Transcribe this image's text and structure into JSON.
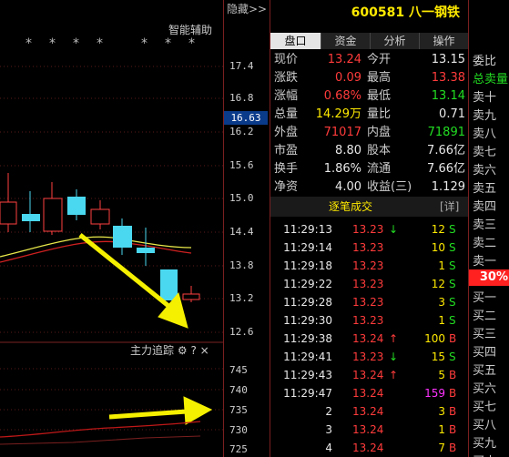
{
  "header": {
    "hide_label": "隐藏>>",
    "code": "600581",
    "name": "八一钢铁",
    "ai_label": "智能辅助"
  },
  "tabs": [
    {
      "label": "盘口",
      "active": true
    },
    {
      "label": "资金"
    },
    {
      "label": "分析"
    },
    {
      "label": "操作"
    }
  ],
  "price_axis": [
    "17.4",
    "16.8",
    "16.2",
    "15.6",
    "15.0",
    "14.4",
    "13.8",
    "13.2",
    "12.6"
  ],
  "current_price": "16.63",
  "vol_axis": [
    "745",
    "740",
    "735",
    "730",
    "725"
  ],
  "indicator": {
    "label": "主力追踪",
    "gear": "gear-icon",
    "help": "?",
    "close": "×"
  },
  "quote": [
    {
      "l1": "现价",
      "v1": "13.24",
      "c1": "red",
      "l2": "今开",
      "v2": "13.15",
      "c2": "white"
    },
    {
      "l1": "涨跌",
      "v1": "0.09",
      "c1": "red",
      "l2": "最高",
      "v2": "13.38",
      "c2": "red"
    },
    {
      "l1": "涨幅",
      "v1": "0.68%",
      "c1": "red",
      "l2": "最低",
      "v2": "13.14",
      "c2": "green"
    },
    {
      "l1": "总量",
      "v1": "14.29万",
      "c1": "yellow",
      "l2": "量比",
      "v2": "0.71",
      "c2": "white"
    },
    {
      "l1": "外盘",
      "v1": "71017",
      "c1": "red",
      "l2": "内盘",
      "v2": "71891",
      "c2": "green"
    },
    {
      "l1": "市盈",
      "v1": "8.80",
      "c1": "white",
      "l2": "股本",
      "v2": "7.66亿",
      "c2": "white"
    },
    {
      "l1": "换手",
      "v1": "1.86%",
      "c1": "white",
      "l2": "流通",
      "v2": "7.66亿",
      "c2": "white"
    },
    {
      "l1": "净资",
      "v1": "4.00",
      "c1": "white",
      "l2": "收益(三)",
      "v2": "1.129",
      "c2": "white"
    }
  ],
  "trades_header": {
    "title": "逐笔成交",
    "detail": "[详]"
  },
  "trades": [
    {
      "t": "11:29:13",
      "p": "13.23",
      "arrow": "↓",
      "ac": "green",
      "v": "12",
      "s": "S",
      "vc": "yellow",
      "sc": "green"
    },
    {
      "t": "11:29:14",
      "p": "13.23",
      "arrow": "",
      "ac": "",
      "v": "10",
      "s": "S",
      "vc": "yellow",
      "sc": "green"
    },
    {
      "t": "11:29:18",
      "p": "13.23",
      "arrow": "",
      "ac": "",
      "v": "1",
      "s": "S",
      "vc": "yellow",
      "sc": "green"
    },
    {
      "t": "11:29:22",
      "p": "13.23",
      "arrow": "",
      "ac": "",
      "v": "12",
      "s": "S",
      "vc": "yellow",
      "sc": "green"
    },
    {
      "t": "11:29:28",
      "p": "13.23",
      "arrow": "",
      "ac": "",
      "v": "3",
      "s": "S",
      "vc": "yellow",
      "sc": "green"
    },
    {
      "t": "11:29:30",
      "p": "13.23",
      "arrow": "",
      "ac": "",
      "v": "1",
      "s": "S",
      "vc": "yellow",
      "sc": "green"
    },
    {
      "t": "11:29:38",
      "p": "13.24",
      "arrow": "↑",
      "ac": "red",
      "v": "100",
      "s": "B",
      "vc": "yellow",
      "sc": "red"
    },
    {
      "t": "11:29:41",
      "p": "13.23",
      "arrow": "↓",
      "ac": "green",
      "v": "15",
      "s": "S",
      "vc": "yellow",
      "sc": "green"
    },
    {
      "t": "11:29:43",
      "p": "13.24",
      "arrow": "↑",
      "ac": "red",
      "v": "5",
      "s": "B",
      "vc": "yellow",
      "sc": "red"
    },
    {
      "t": "11:29:47",
      "p": "13.24",
      "arrow": "",
      "ac": "",
      "v": "159",
      "s": "B",
      "vc": "magenta",
      "sc": "red"
    },
    {
      "t": "2",
      "p": "13.24",
      "arrow": "",
      "ac": "",
      "v": "3",
      "s": "B",
      "vc": "yellow",
      "sc": "red"
    },
    {
      "t": "3",
      "p": "13.24",
      "arrow": "",
      "ac": "",
      "v": "1",
      "s": "B",
      "vc": "yellow",
      "sc": "red"
    },
    {
      "t": "4",
      "p": "13.24",
      "arrow": "",
      "ac": "",
      "v": "7",
      "s": "B",
      "vc": "yellow",
      "sc": "red"
    }
  ],
  "sidebar": [
    {
      "label": "委比",
      "c": "white"
    },
    {
      "label": "总卖量",
      "c": "green"
    },
    {
      "label": "卖十"
    },
    {
      "label": "卖九"
    },
    {
      "label": "卖八"
    },
    {
      "label": "卖七"
    },
    {
      "label": "卖六"
    },
    {
      "label": "卖五"
    },
    {
      "label": "卖四"
    },
    {
      "label": "卖三"
    },
    {
      "label": "卖二"
    },
    {
      "label": "卖一"
    },
    {
      "label": "30%",
      "badge": true
    },
    {
      "label": "买一"
    },
    {
      "label": "买二"
    },
    {
      "label": "买三"
    },
    {
      "label": "买四"
    },
    {
      "label": "买五"
    },
    {
      "label": "买六"
    },
    {
      "label": "买七"
    },
    {
      "label": "买八"
    },
    {
      "label": "买九"
    },
    {
      "label": "买十"
    }
  ]
}
